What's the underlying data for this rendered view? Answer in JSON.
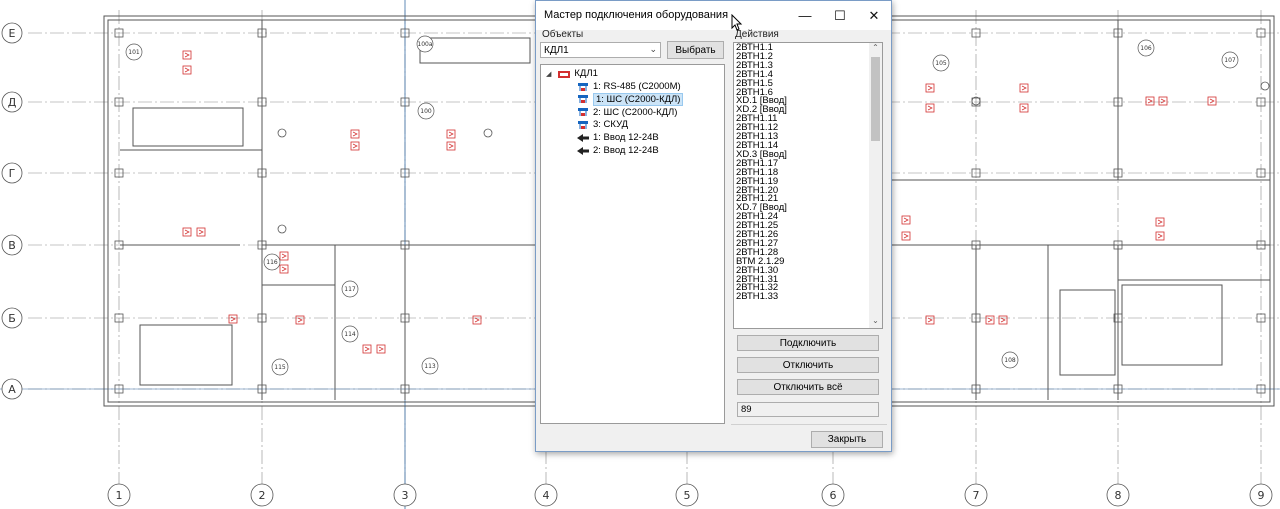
{
  "drawing": {
    "row_axes": [
      "Е",
      "Д",
      "Г",
      "В",
      "Б",
      "А"
    ],
    "column_axes": [
      "1",
      "2",
      "3",
      "4",
      "5",
      "6",
      "7",
      "8",
      "9"
    ],
    "rooms": [
      "101",
      "100a",
      "100",
      "105",
      "106",
      "107",
      "116",
      "117",
      "114",
      "115",
      "113",
      "108"
    ]
  },
  "dialog": {
    "title": "Мастер подключения оборудования",
    "window_buttons": {
      "minimize": "—",
      "maximize": "☐",
      "close": "✕"
    },
    "objects_label": "Объекты",
    "object_select": "КДЛ1",
    "select_button": "Выбрать",
    "tree": {
      "root": "КДЛ1",
      "children": [
        {
          "label": "1: RS-485 (С2000М)",
          "icon": "bus-icon",
          "selected": false
        },
        {
          "label": "1: ШС  (С2000-КДЛ)",
          "icon": "loop-icon",
          "selected": true
        },
        {
          "label": "2: ШС  (С2000-КДЛ)",
          "icon": "loop-icon",
          "selected": false
        },
        {
          "label": "3: СКУД",
          "icon": "access-icon",
          "selected": false
        },
        {
          "label": "1: Ввод 12-24В",
          "icon": "power-input-icon",
          "selected": false
        },
        {
          "label": "2: Ввод 12-24В",
          "icon": "power-input-icon",
          "selected": false
        }
      ]
    },
    "actions_label": "Действия",
    "actions": [
      "2ВТН1.1",
      "2ВТН1.2",
      "2ВТН1.3",
      "2ВТН1.4",
      "2ВТН1.5",
      "2ВТН1.6",
      "XD.1 [Ввод]",
      "XD.2 [Ввод]",
      "2ВТН1.11",
      "2ВТН1.12",
      "2ВТН1.13",
      "2ВТН1.14",
      "XD.3 [Ввод]",
      "2ВТН1.17",
      "2ВТН1.18",
      "2ВТН1.19",
      "2ВТН1.20",
      "2ВТН1.21",
      "XD.7 [Ввод]",
      "2ВТН1.24",
      "2ВТН1.25",
      "2ВТН1.26",
      "2ВТН1.27",
      "2ВТН1.28",
      "ВТМ 2.1.29",
      "2ВТН1.30",
      "2ВТН1.31",
      "2ВТН1.32",
      "2ВТН1.33"
    ],
    "connect_button": "Подключить",
    "disconnect_button": "Отключить",
    "disconnect_all_button": "Отключить всё",
    "count_value": "89",
    "close_button": "Закрыть"
  }
}
